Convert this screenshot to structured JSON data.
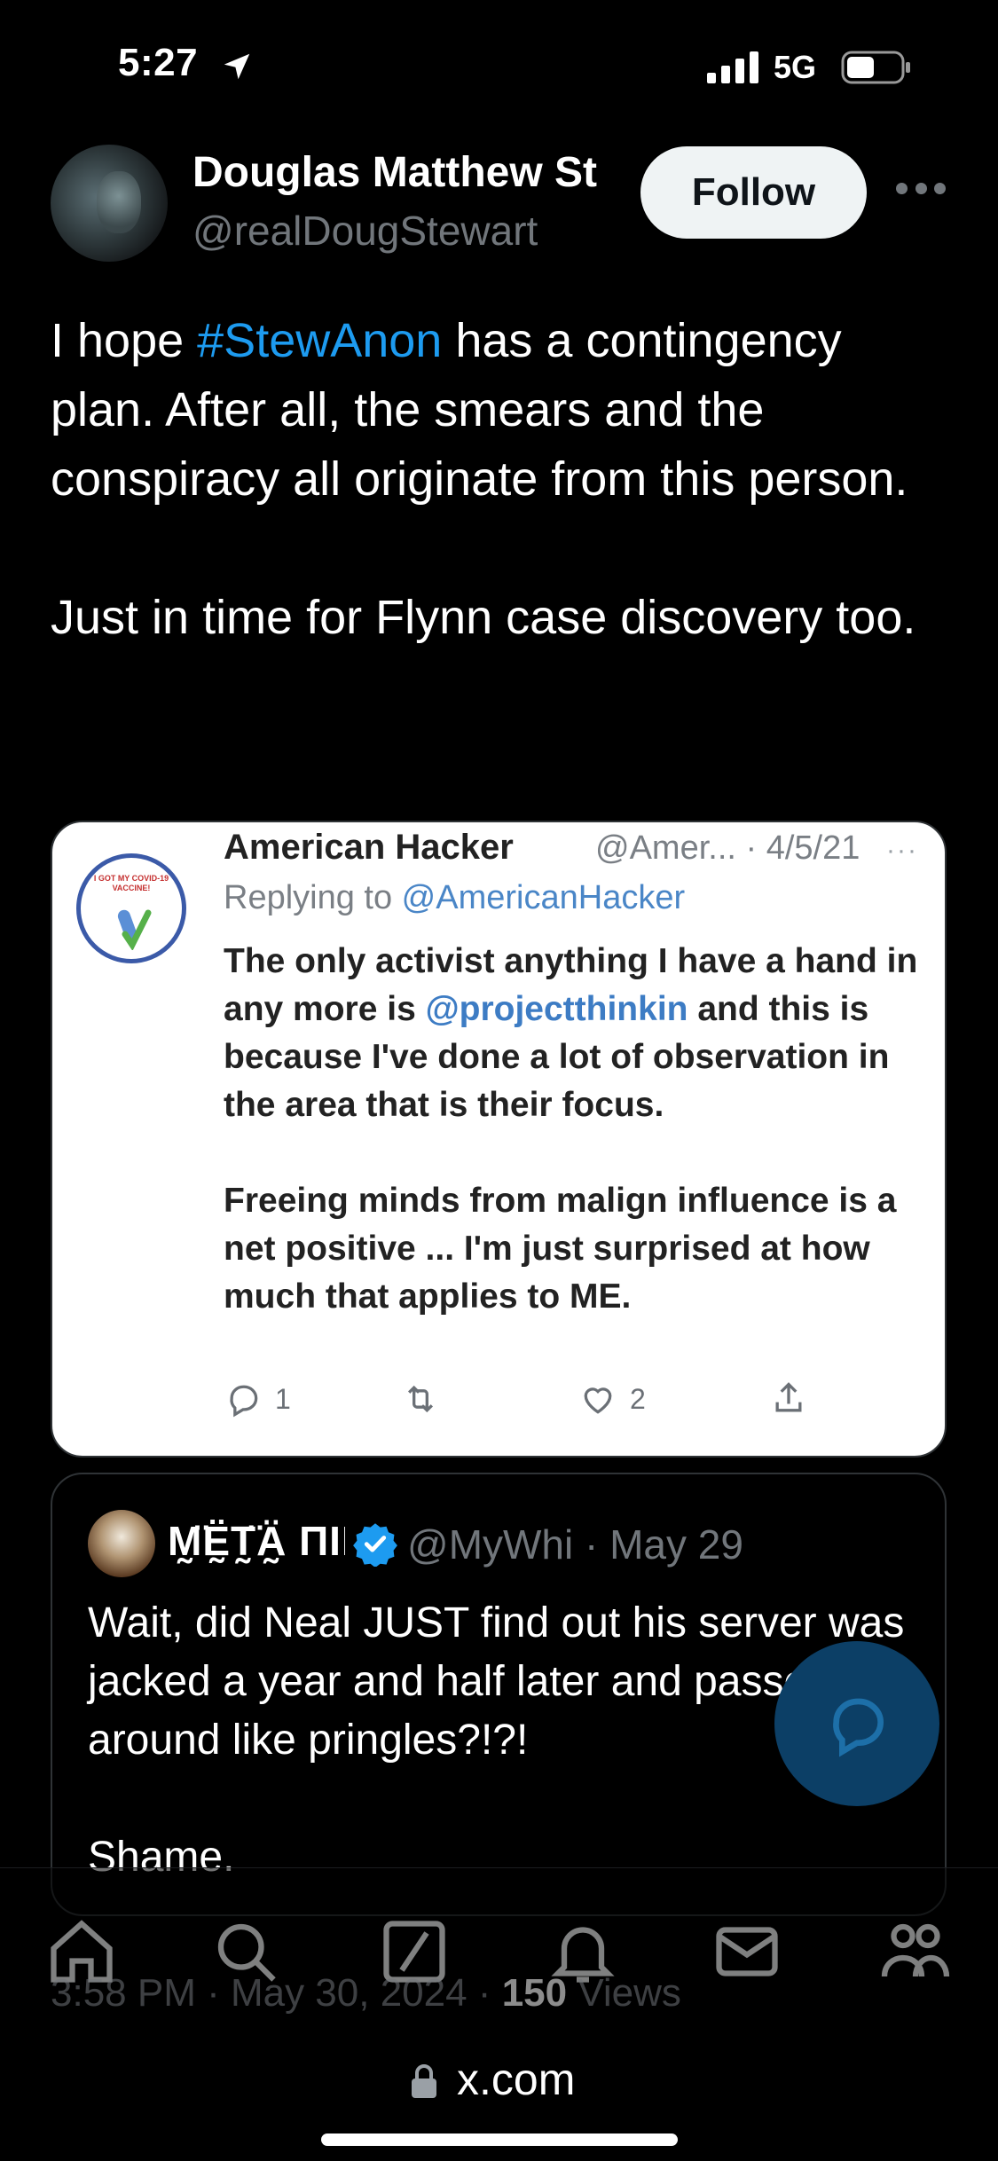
{
  "status_bar": {
    "time": "5:27",
    "network": "5G"
  },
  "author": {
    "display_name": "Douglas Matthew St",
    "handle": "@realDougStewart"
  },
  "follow_label": "Follow",
  "tweet": {
    "pre": "I hope ",
    "hashtag": "#StewAnon",
    "post": " has a contingency plan. After all, the smears and the conspiracy all originate from this person.",
    "para2": "Just in time for Flynn case discovery too."
  },
  "embedded": {
    "avatar_text": "I GOT MY COVID-19 VACCINE!",
    "name": "American Hacker",
    "handle_date": "@Amer... · 4/5/21",
    "replying_prefix": "Replying to ",
    "replying_handle": "@AmericanHacker",
    "body1_pre": "The only activist anything I have a hand in any more is ",
    "body1_link": "@projectthinkin",
    "body1_post": " and this is because I've done a lot of observation in the area that is their focus.",
    "body2": "Freeing minds from malign influence is a net positive ... I'm just surprised at how much that applies to ME.",
    "reply_count": "1",
    "like_count": "2"
  },
  "quote": {
    "name": "M̰̈Ḛ̈T̰̈Ä̰ ПIПJΛ C",
    "handle_date": "@MyWhi · May 29",
    "text": "Wait, did Neal JUST find out his server was jacked a year and half later and passed around like pringles?!?!",
    "text2": "Shame."
  },
  "timestamp": {
    "time": "3:58 PM · May 30, 2024 · ",
    "views": "150",
    "views_label": " Views"
  },
  "url": "x.com",
  "colors": {
    "accent": "#1d9bf0",
    "background": "#000000",
    "muted": "#71767b"
  }
}
